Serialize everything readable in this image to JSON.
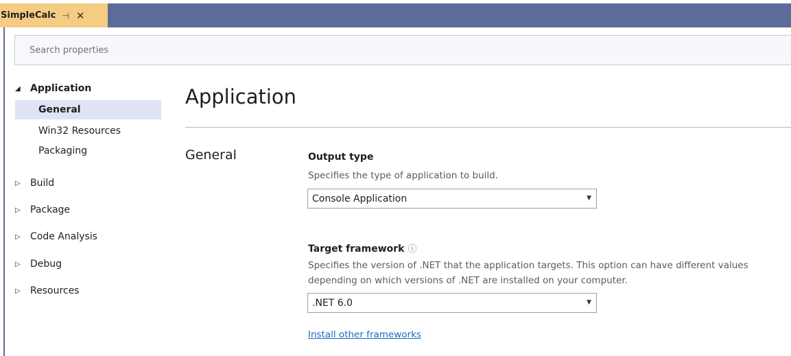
{
  "tab": {
    "title": "SimpleCalc",
    "pin_icon": "pin-icon",
    "close_icon": "close-icon"
  },
  "search": {
    "placeholder": "Search properties"
  },
  "nav": {
    "application": {
      "label": "Application",
      "expanded": true
    },
    "children": [
      {
        "label": "General",
        "selected": true
      },
      {
        "label": "Win32 Resources"
      },
      {
        "label": "Packaging"
      }
    ],
    "groups": [
      {
        "label": "Build"
      },
      {
        "label": "Package"
      },
      {
        "label": "Code Analysis"
      },
      {
        "label": "Debug"
      },
      {
        "label": "Resources"
      }
    ]
  },
  "content": {
    "page_title": "Application",
    "section_title": "General",
    "output_type": {
      "title": "Output type",
      "description": "Specifies the type of application to build.",
      "value": "Console Application"
    },
    "target_framework": {
      "title": "Target framework",
      "help_icon": "help-circle-icon",
      "description": "Specifies the version of .NET that the application targets. This option can have different values depending on which versions of .NET are installed on your computer.",
      "value": ".NET 6.0"
    },
    "install_link": "Install other frameworks"
  },
  "colors": {
    "tab_bg": "#f5cc84",
    "tabstrip_bg": "#5d6b99",
    "selection_bg": "#dfe3f5",
    "link": "#1a67c4"
  }
}
